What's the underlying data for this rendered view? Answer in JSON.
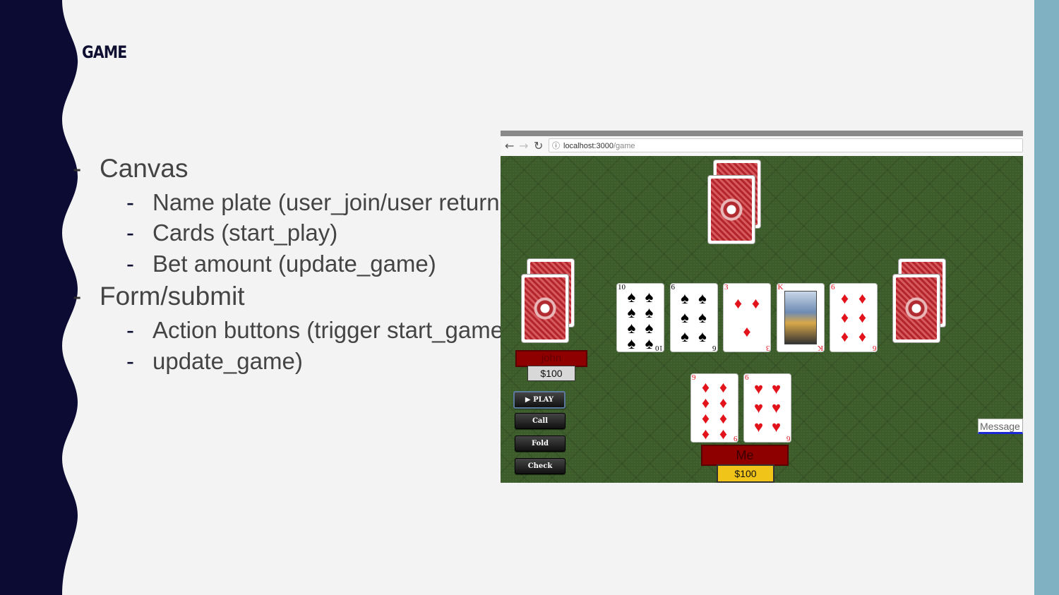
{
  "slide": {
    "title": "GAME",
    "bullets": [
      {
        "text": "Canvas",
        "sub": [
          "Name plate (user_join/user return",
          "Cards (start_play)",
          "Bet amount (update_game)"
        ]
      },
      {
        "text": "Form/submit",
        "sub": [
          "Action buttons (trigger start_game",
          "update_game)"
        ]
      }
    ],
    "dash": "-"
  },
  "browser": {
    "url_host": "localhost:3000",
    "url_path": "/game",
    "back_icon": "arrow-left-icon",
    "forward_icon": "arrow-right-icon",
    "reload_icon": "reload-icon",
    "info_icon": "info-icon"
  },
  "game": {
    "community_cards": [
      {
        "rank": "10",
        "suit": "♠",
        "color": "black"
      },
      {
        "rank": "6",
        "suit": "♠",
        "color": "black"
      },
      {
        "rank": "3",
        "suit": "♦",
        "color": "red"
      },
      {
        "rank": "K",
        "suit": "♥",
        "color": "red"
      },
      {
        "rank": "6",
        "suit": "♦",
        "color": "red"
      }
    ],
    "player_cards": [
      {
        "rank": "9",
        "suit": "♦",
        "color": "red"
      },
      {
        "rank": "6",
        "suit": "♥",
        "color": "red"
      }
    ],
    "opponent": {
      "name": "john",
      "bet": "$100"
    },
    "me": {
      "name": "Me",
      "bet": "$100"
    },
    "buttons": {
      "play": "PLAY",
      "call": "Call",
      "fold": "Fold",
      "check": "Check"
    },
    "play_icon": "▶",
    "message_placeholder": "Message",
    "colors": {
      "felt": "#3c5d2a",
      "plate": "#8e0000",
      "chip_me": "#f0c419",
      "chip_opponent": "#d8d8d8",
      "accent": "#1a2bd6"
    }
  }
}
